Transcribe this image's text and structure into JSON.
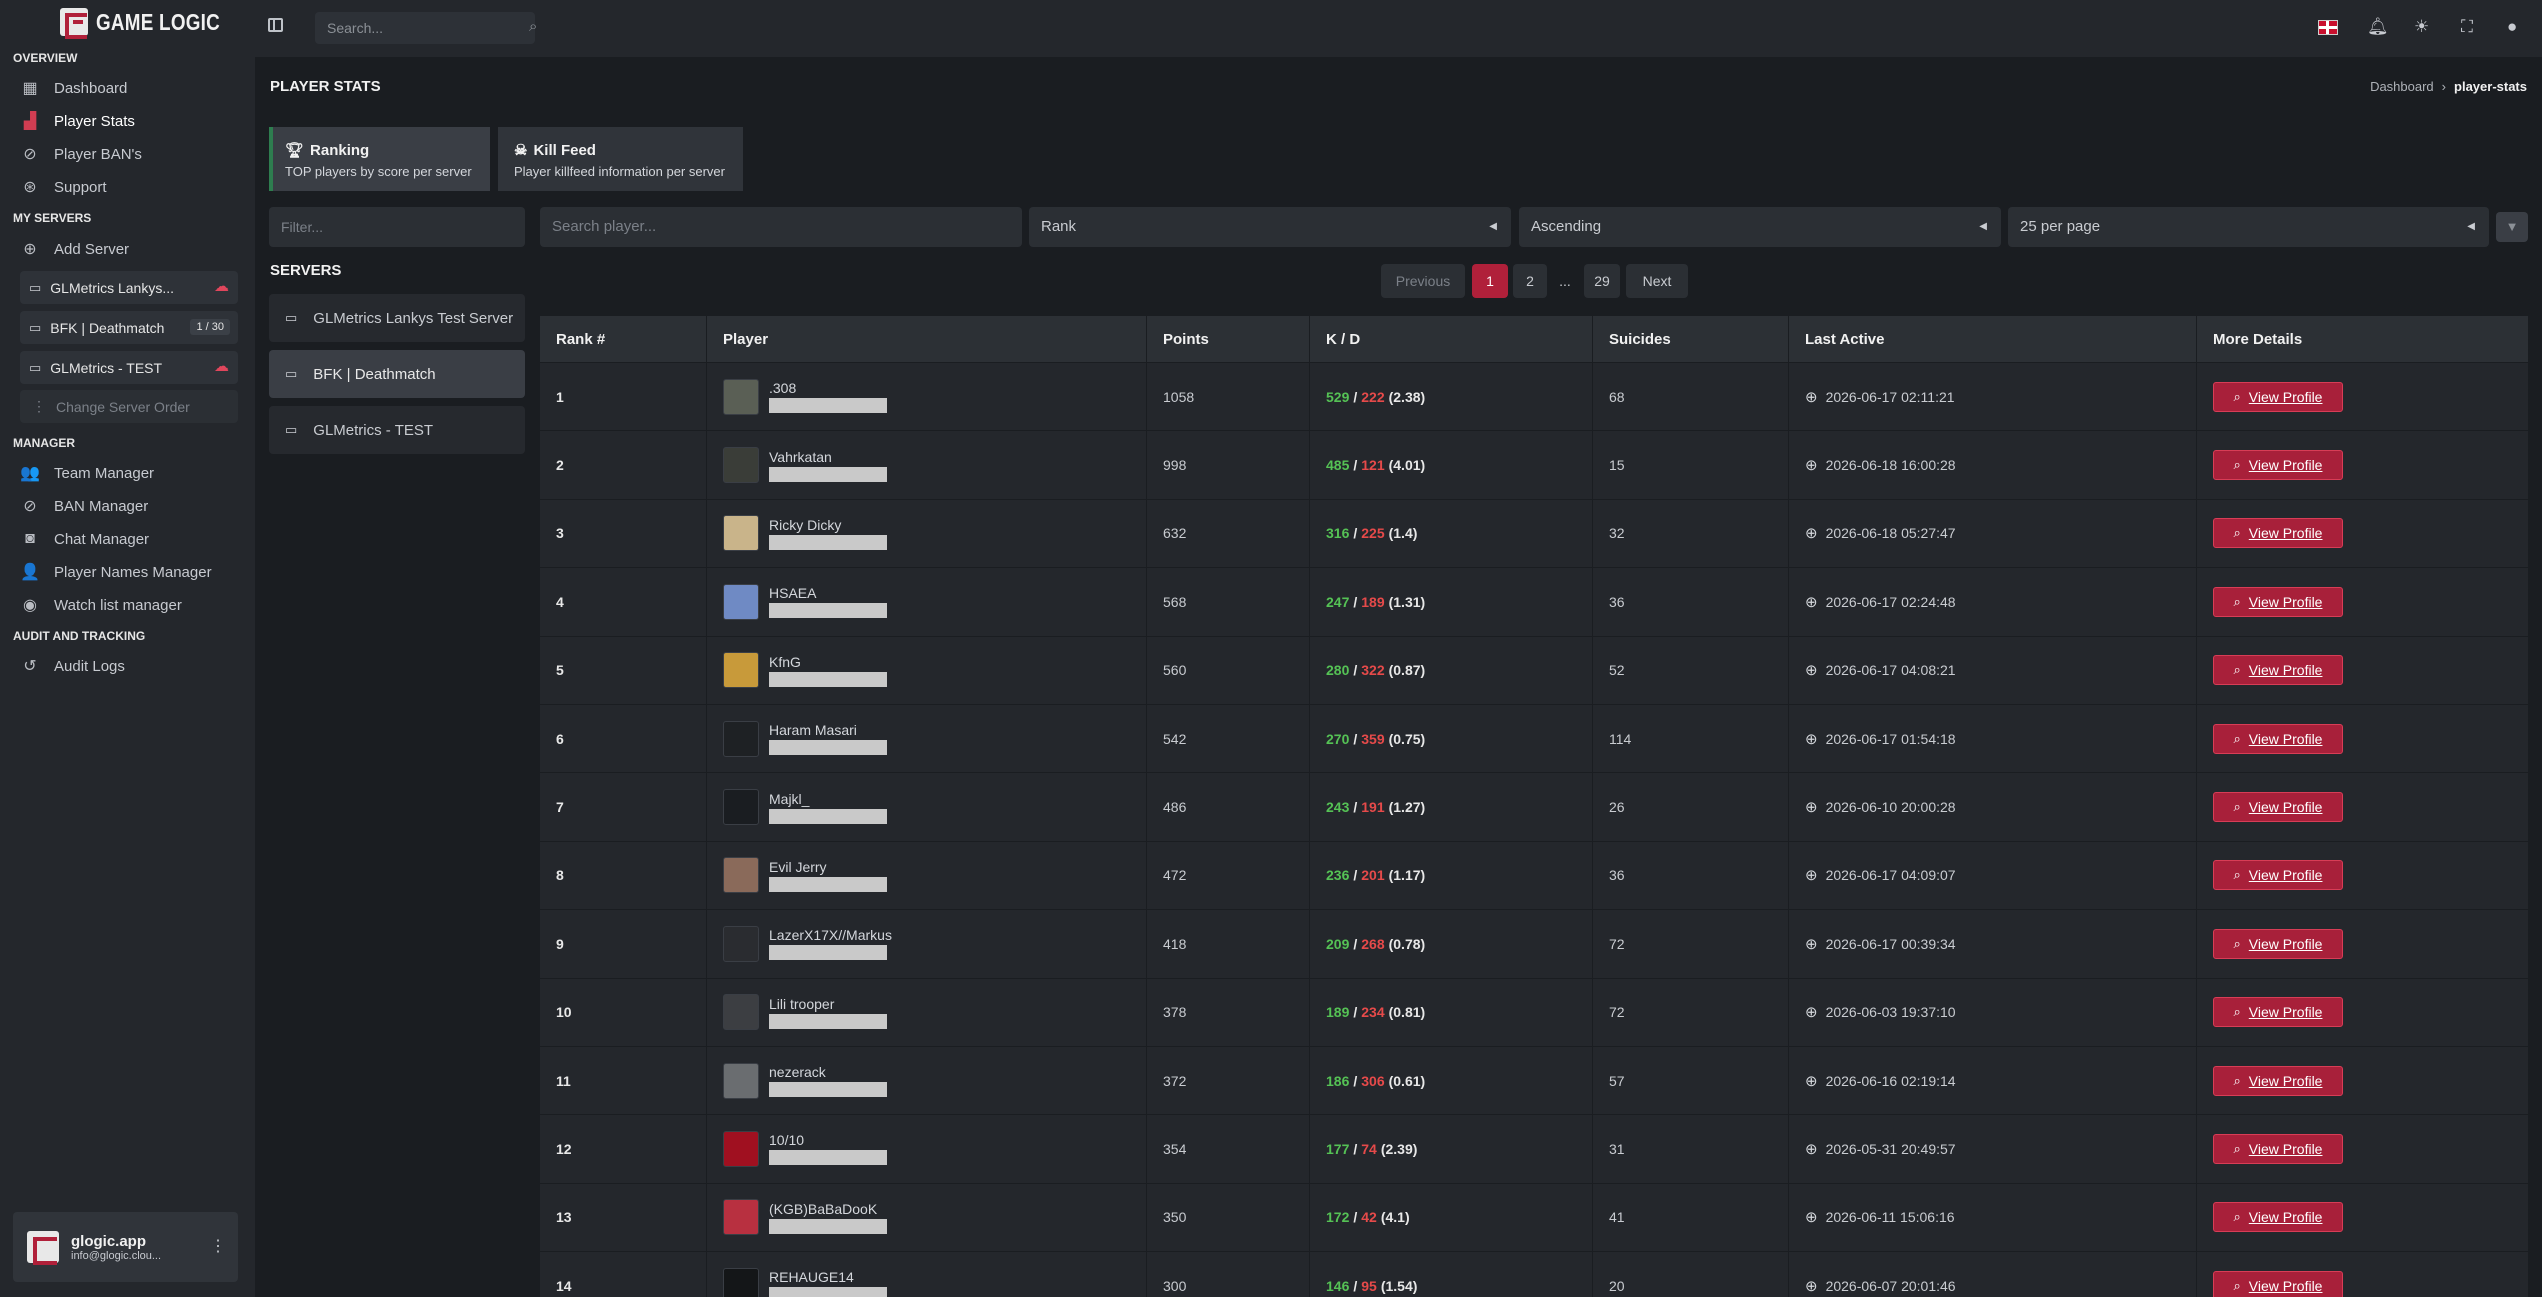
{
  "brand": {
    "name": "GAME LOGIC"
  },
  "sidebar": {
    "section_overview": "OVERVIEW",
    "overview": [
      {
        "label": "Dashboard",
        "icon": "dashboard-icon"
      },
      {
        "label": "Player Stats",
        "icon": "chart-icon",
        "active": true
      },
      {
        "label": "Player BAN's",
        "icon": "ban-icon"
      },
      {
        "label": "Support",
        "icon": "support-icon"
      }
    ],
    "section_servers": "MY SERVERS",
    "add_server": "Add Server",
    "servers": [
      {
        "label": "GLMetrics Lankys...",
        "status": "offline"
      },
      {
        "label": "BFK | Deathmatch",
        "tag": "1 / 30"
      },
      {
        "label": "GLMetrics - TEST",
        "status": "offline"
      }
    ],
    "change_order": "Change Server Order",
    "section_manager": "MANAGER",
    "manager": [
      {
        "label": "Team Manager",
        "icon": "users-icon"
      },
      {
        "label": "BAN Manager",
        "icon": "ban-icon"
      },
      {
        "label": "Chat Manager",
        "icon": "chat-icon"
      },
      {
        "label": "Player Names Manager",
        "icon": "user-edit-icon"
      },
      {
        "label": "Watch list manager",
        "icon": "eye-icon"
      }
    ],
    "section_audit": "AUDIT AND TRACKING",
    "audit": [
      {
        "label": "Audit Logs",
        "icon": "history-icon"
      }
    ],
    "user": {
      "name": "glogic.app",
      "email": "info@glogic.clou..."
    }
  },
  "topbar": {
    "search_placeholder": "Search..."
  },
  "page": {
    "title": "PLAYER STATS",
    "breadcrumb_root": "Dashboard",
    "breadcrumb_current": "player-stats"
  },
  "tabs": [
    {
      "title": "Ranking",
      "subtitle": "TOP players by score per server"
    },
    {
      "title": "Kill Feed",
      "subtitle": "Player killfeed information per server"
    }
  ],
  "filter_placeholder": "Filter...",
  "servers_heading": "SERVERS",
  "server_list": [
    "GLMetrics Lankys Test Server",
    "BFK | Deathmatch",
    "GLMetrics - TEST"
  ],
  "controls": {
    "player_search_placeholder": "Search player...",
    "sort_by": "Rank",
    "order": "Ascending",
    "per_page": "25 per page"
  },
  "pagination": {
    "previous": "Previous",
    "pages": [
      "1",
      "2",
      "...",
      "29"
    ],
    "next": "Next",
    "current": "1"
  },
  "table": {
    "headers": [
      "Rank #",
      "Player",
      "Points",
      "K / D",
      "Suicides",
      "Last Active",
      "More Details"
    ],
    "button_label": "View Profile",
    "rows": [
      {
        "rank": "1",
        "player": ".308",
        "points": "1058",
        "kills": "529",
        "deaths": "222",
        "ratio": "(2.38)",
        "suicides": "68",
        "last_active": "2026-06-17 02:11:21",
        "avatar": "#5a5f55"
      },
      {
        "rank": "2",
        "player": "Vahrkatan",
        "points": "998",
        "kills": "485",
        "deaths": "121",
        "ratio": "(4.01)",
        "suicides": "15",
        "last_active": "2026-06-18 16:00:28",
        "avatar": "#3a3d38"
      },
      {
        "rank": "3",
        "player": "Ricky Dicky",
        "points": "632",
        "kills": "316",
        "deaths": "225",
        "ratio": "(1.4)",
        "suicides": "32",
        "last_active": "2026-06-18 05:27:47",
        "avatar": "#c9b48a"
      },
      {
        "rank": "4",
        "player": "HSAEA",
        "points": "568",
        "kills": "247",
        "deaths": "189",
        "ratio": "(1.31)",
        "suicides": "36",
        "last_active": "2026-06-17 02:24:48",
        "avatar": "#6f8ac4"
      },
      {
        "rank": "5",
        "player": "KfnG",
        "points": "560",
        "kills": "280",
        "deaths": "322",
        "ratio": "(0.87)",
        "suicides": "52",
        "last_active": "2026-06-17 04:08:21",
        "avatar": "#c89a3a"
      },
      {
        "rank": "6",
        "player": "Haram Masari",
        "points": "542",
        "kills": "270",
        "deaths": "359",
        "ratio": "(0.75)",
        "suicides": "114",
        "last_active": "2026-06-17 01:54:18",
        "avatar": "#1e2124"
      },
      {
        "rank": "7",
        "player": "Majkl_",
        "points": "486",
        "kills": "243",
        "deaths": "191",
        "ratio": "(1.27)",
        "suicides": "26",
        "last_active": "2026-06-10 20:00:28",
        "avatar": "#1a1d21"
      },
      {
        "rank": "8",
        "player": "Evil Jerry",
        "points": "472",
        "kills": "236",
        "deaths": "201",
        "ratio": "(1.17)",
        "suicides": "36",
        "last_active": "2026-06-17 04:09:07",
        "avatar": "#8a6a5a"
      },
      {
        "rank": "9",
        "player": "LazerX17X//Markus",
        "points": "418",
        "kills": "209",
        "deaths": "268",
        "ratio": "(0.78)",
        "suicides": "72",
        "last_active": "2026-06-17 00:39:34",
        "avatar": "#2a2c30"
      },
      {
        "rank": "10",
        "player": "Lili trooper",
        "points": "378",
        "kills": "189",
        "deaths": "234",
        "ratio": "(0.81)",
        "suicides": "72",
        "last_active": "2026-06-03 19:37:10",
        "avatar": "#3c3e42"
      },
      {
        "rank": "11",
        "player": "nezerack",
        "points": "372",
        "kills": "186",
        "deaths": "306",
        "ratio": "(0.61)",
        "suicides": "57",
        "last_active": "2026-06-16 02:19:14",
        "avatar": "#6a6d70"
      },
      {
        "rank": "12",
        "player": "10/10",
        "points": "354",
        "kills": "177",
        "deaths": "74",
        "ratio": "(2.39)",
        "suicides": "31",
        "last_active": "2026-05-31 20:49:57",
        "avatar": "#a01020"
      },
      {
        "rank": "13",
        "player": "(KGB)BaBaDooK",
        "points": "350",
        "kills": "172",
        "deaths": "42",
        "ratio": "(4.1)",
        "suicides": "41",
        "last_active": "2026-06-11 15:06:16",
        "avatar": "#b83040"
      },
      {
        "rank": "14",
        "player": "REHAUGE14",
        "points": "300",
        "kills": "146",
        "deaths": "95",
        "ratio": "(1.54)",
        "suicides": "20",
        "last_active": "2026-06-07 20:01:46",
        "avatar": "#141618"
      }
    ]
  }
}
